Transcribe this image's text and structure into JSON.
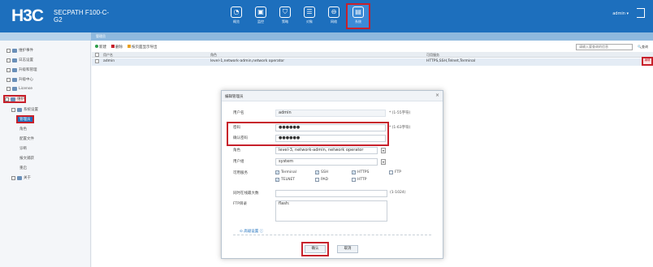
{
  "header": {
    "logo": "H3C",
    "product_line1": "SECPATH F100-C-",
    "product_line2": "G2",
    "nav": [
      {
        "label": "概览",
        "icon": "dashboard-icon",
        "glyph": "◔"
      },
      {
        "label": "监控",
        "icon": "monitor-icon",
        "glyph": "▣"
      },
      {
        "label": "策略",
        "icon": "shield-icon",
        "glyph": "⛉"
      },
      {
        "label": "对象",
        "icon": "object-icon",
        "glyph": "☰"
      },
      {
        "label": "网络",
        "icon": "network-icon",
        "glyph": "⊖"
      },
      {
        "label": "系统",
        "icon": "system-icon",
        "glyph": "▤"
      }
    ],
    "user": "admin ▾"
  },
  "subbar": {
    "crumb": "管理员"
  },
  "sidebar": {
    "items": [
      {
        "label": "维护事件"
      },
      {
        "label": "日志设置"
      },
      {
        "label": "升级和管理"
      },
      {
        "label": "升级中心"
      },
      {
        "label": "License"
      },
      {
        "label": "维护"
      },
      {
        "label": "系统设置"
      },
      {
        "label": "管理员"
      },
      {
        "label": "角色"
      },
      {
        "label": "配置文件"
      },
      {
        "label": "诊断"
      },
      {
        "label": "报文捕获"
      },
      {
        "label": "重启"
      },
      {
        "label": "关于"
      }
    ]
  },
  "toolbar": {
    "new": "新建",
    "delete": "删除",
    "export": "按页面显示导出",
    "search_placeholder": "请输入要查询的信息",
    "search": "查询"
  },
  "table": {
    "headers": [
      "用户名",
      "角色",
      "可用服务"
    ],
    "rows": [
      {
        "username": "admin",
        "role": "level-1,network-admin,network operator",
        "services": "HTTPS,SSH,Telnet,Terminal",
        "action": "编辑"
      }
    ]
  },
  "dialog": {
    "title": "编辑管理员",
    "close": "×",
    "username_label": "用户名",
    "username_value": "admin",
    "username_hint": "* (1-55字符)",
    "password_label": "密码",
    "password_value": "●●●●●●",
    "password_hint": "* (1-63字符)",
    "confirm_label": "确认密码",
    "confirm_value": "●●●●●●",
    "role_label": "角色",
    "role_value": "level-3, network-admin, network operator",
    "group_label": "用户组",
    "group_value": "system",
    "services_label": "可用服务",
    "services": [
      {
        "label": "Terminal",
        "checked": true
      },
      {
        "label": "SSH",
        "checked": true
      },
      {
        "label": "HTTPS",
        "checked": true
      },
      {
        "label": "FTP",
        "checked": false
      },
      {
        "label": "TELNET",
        "checked": true
      },
      {
        "label": "PAD",
        "checked": false
      },
      {
        "label": "HTTP",
        "checked": false
      }
    ],
    "max_login_label": "同时在线最大数",
    "max_login_hint": "(1-1024)",
    "ftp_label": "FTP目录",
    "ftp_value": "flash:",
    "advanced": "高级设置",
    "ok": "确认",
    "cancel": "取消"
  }
}
